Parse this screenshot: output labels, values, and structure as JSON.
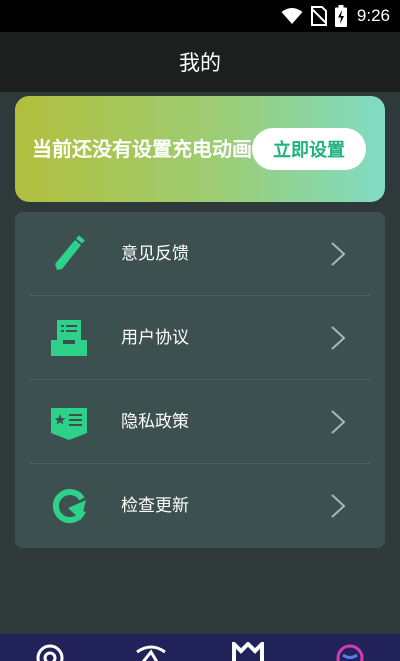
{
  "status_bar": {
    "time": "9:26",
    "icons": [
      "wifi-icon",
      "no-sim-icon",
      "battery-charging-icon"
    ]
  },
  "header": {
    "title": "我的"
  },
  "banner": {
    "text": "当前还没有设置充电动画",
    "button_label": "立即设置",
    "colors": {
      "start": "#b1bf3d",
      "end": "#80dcc4"
    }
  },
  "menu": {
    "items": [
      {
        "label": "意见反馈",
        "icon": "pencil-icon"
      },
      {
        "label": "用户协议",
        "icon": "document-tray-icon"
      },
      {
        "label": "隐私政策",
        "icon": "privacy-card-icon"
      },
      {
        "label": "检查更新",
        "icon": "refresh-icon"
      }
    ]
  },
  "bottom_nav": {
    "tabs": [
      {
        "icon": "target-icon"
      },
      {
        "icon": "animation-icon"
      },
      {
        "icon": "crown-icon"
      },
      {
        "icon": "profile-icon"
      }
    ]
  },
  "colors": {
    "accent": "#2ed18a",
    "background": "#2e3a3a",
    "card": "#3c514f",
    "header": "#1d1f1f",
    "nav": "#22225a"
  }
}
